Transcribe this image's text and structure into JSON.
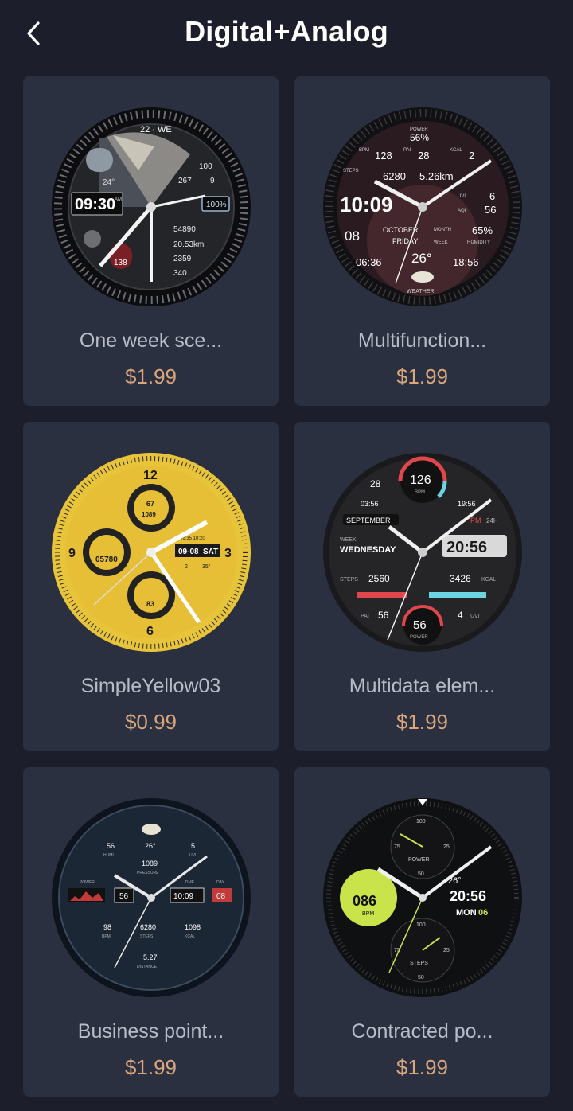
{
  "header": {
    "title": "Digital+Analog",
    "back_icon": "chevron-left-icon"
  },
  "colors": {
    "background": "#1c1f2b",
    "card": "#2b3040",
    "price": "#d8a57c",
    "name": "#b8bcc9"
  },
  "items": [
    {
      "name": "One week sce...",
      "price": "$1.99",
      "face": {
        "date": "22 · WE",
        "time": "09:30",
        "ampm": "AM",
        "temp": "24°",
        "battery": "100%",
        "rain": "100",
        "uv_a": "267",
        "uv_b": "9",
        "heart": "138",
        "steps": "54890",
        "distance": "20.53km",
        "calories": "2359",
        "pai": "340"
      }
    },
    {
      "name": "Multifunction...",
      "price": "$1.99",
      "face": {
        "power_label": "POWER",
        "power": "56%",
        "bpm_label": "BPM",
        "bpm": "128",
        "pai_label": "PAI",
        "pai": "28",
        "kcal_label": "KCAL",
        "kcal": "2",
        "steps_label": "STEPS",
        "steps": "6280",
        "distance": "5.26km",
        "time": "10:09",
        "uvi_label": "UVI",
        "uvi": "6",
        "aqi_label": "AQI",
        "aqi": "56",
        "day": "08",
        "month": "OCTOBER",
        "month_label": "MONTH",
        "weekday": "FRIDAY",
        "week_label": "WEEK",
        "humidity_label": "HUMIDITY",
        "humidity": "65%",
        "sunrise": "06:36",
        "temp": "26°",
        "sunset": "18:56",
        "weather_label": "WEATHER"
      }
    },
    {
      "name": "SimpleYellow03",
      "price": "$0.99",
      "face": {
        "sub_top": "67",
        "sub_top_b": "1089",
        "sub_left": "05780",
        "sub_bottom": "83",
        "date": "09-08",
        "weekday": "SAT",
        "small_time": "06:35 10:20",
        "info_a": "2",
        "info_b": "35°"
      }
    },
    {
      "name": "Multidata elem...",
      "price": "$1.99",
      "face": {
        "bpm": "126",
        "bpm_label": "BPM",
        "day": "28",
        "sunrise": "03:56",
        "sunset": "19:56",
        "month": "SEPTEMBER",
        "mode": "PM",
        "hours": "24H",
        "week_label": "WEEK",
        "weekday": "WEDNESDAY",
        "time": "20:56",
        "steps_label": "STEPS",
        "steps": "2560",
        "kcal": "3426",
        "kcal_label": "KCAL",
        "pai_label": "PAI",
        "pai": "56",
        "power": "56",
        "power_label": "POWER",
        "uvi": "4",
        "uvi_label": "UVI"
      }
    },
    {
      "name": "Business point...",
      "price": "$1.99",
      "face": {
        "humi": "56",
        "humi_label": "HUMI",
        "temp": "26°",
        "uvi": "5",
        "uvi_label": "UVI",
        "pressure": "1089",
        "pressure_label": "PRESSURE",
        "power_label": "POWER",
        "power": "56",
        "time_label": "TIME",
        "time": "10:09",
        "day_label": "DAY",
        "day": "08",
        "bpm": "98",
        "bpm_label": "BPM",
        "steps": "6280",
        "steps_label": "STEPS",
        "kcal": "1098",
        "kcal_label": "KCAL",
        "distance": "5.27",
        "distance_label": "DISTANCE"
      }
    },
    {
      "name": "Contracted po...",
      "price": "$1.99",
      "face": {
        "top_100": "100",
        "top_75": "75",
        "top_25": "25",
        "top_50": "50",
        "power_label": "POWER",
        "heart": "086",
        "bpm_label": "BPM",
        "temp": "26°",
        "time": "20:56",
        "weekday": "MON",
        "day": "06",
        "bot_100": "100",
        "bot_75": "75",
        "bot_25": "25",
        "bot_50": "50",
        "steps_label": "STEPS"
      }
    }
  ]
}
